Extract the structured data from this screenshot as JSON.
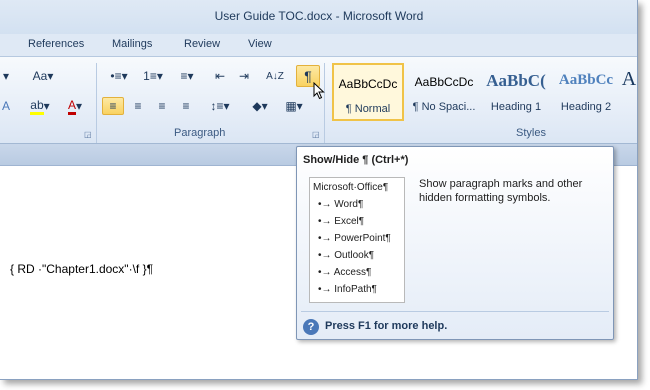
{
  "window": {
    "title": "User Guide TOC.docx - Microsoft Word"
  },
  "tabs": [
    "References",
    "Mailings",
    "Review",
    "View"
  ],
  "groups": {
    "paragraph": "Paragraph",
    "styles": "Styles"
  },
  "toolbar": {
    "font_size": "Aa",
    "grow": "A",
    "highlight": "ab",
    "font_color": "A",
    "bullets": "•≡",
    "numbering": "1≡",
    "multilevel": "≡",
    "dec_indent": "⇤",
    "inc_indent": "⇥",
    "sort": "A↓Z",
    "show_hide": "¶",
    "align_left": "≡",
    "center": "≡",
    "align_right": "≡",
    "justify": "≡",
    "line_spacing": "↕≡",
    "shading": "◆",
    "borders": "▦"
  },
  "styles": [
    {
      "preview": "AaBbCcDc",
      "name": "¶ Normal",
      "selected": true
    },
    {
      "preview": "AaBbCcDc",
      "name": "¶ No Spaci...",
      "selected": false
    },
    {
      "preview": "AaBbC(",
      "name": "Heading 1",
      "selected": false
    },
    {
      "preview": "AaBbCc",
      "name": "Heading 2",
      "selected": false
    },
    {
      "preview": "A",
      "name": "",
      "selected": false
    }
  ],
  "document": {
    "field_code": "{ RD ·\"Chapter1.docx\"·\\f }¶"
  },
  "tooltip": {
    "title": "Show/Hide ¶ (Ctrl+*)",
    "example": [
      "Microsoft·Office¶",
      "•→ Word¶",
      "•→ Excel¶",
      "•→ PowerPoint¶",
      "•→ Outlook¶",
      "•→ Access¶",
      "•→ InfoPath¶"
    ],
    "description": "Show paragraph marks and other hidden formatting symbols.",
    "help": "Press F1 for more help."
  }
}
